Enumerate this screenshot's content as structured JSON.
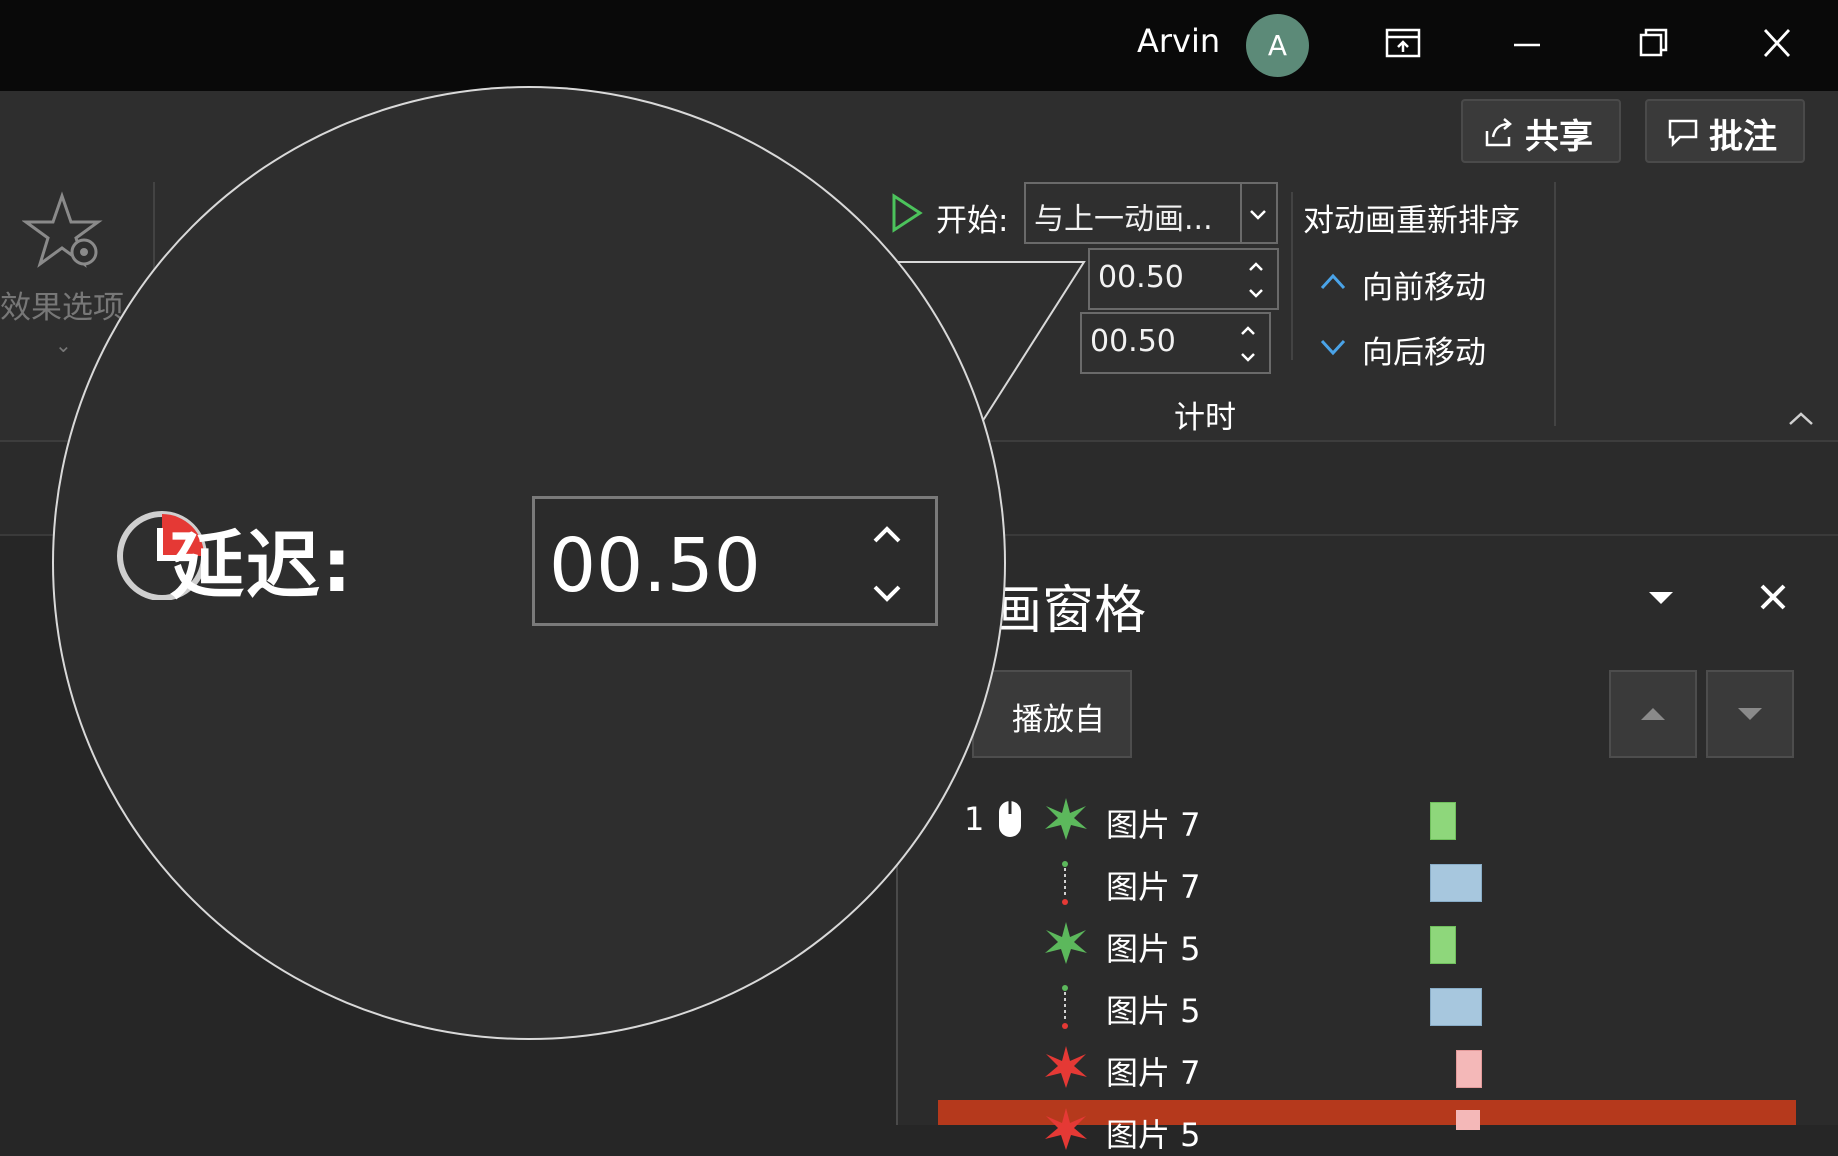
{
  "titlebar": {
    "user_name": "Arvin",
    "avatar_initial": "A",
    "icons": [
      "present-icon",
      "minimize-icon",
      "restore-icon",
      "close-icon"
    ]
  },
  "header_buttons": {
    "share_label": "共享",
    "comment_label": "批注"
  },
  "ribbon": {
    "effect_options_label": "效果选项",
    "start_label": "开始:",
    "start_value": "与上一动画...",
    "duration_value": "00.50",
    "delay_value": "00.50",
    "timing_group_label": "计时",
    "reorder_title": "对动画重新排序",
    "move_earlier_label": "向前移动",
    "move_later_label": "向后移动"
  },
  "animation_pane": {
    "title": "画窗格",
    "play_from_label": "播放自",
    "items": [
      {
        "index": "1",
        "name": "图片 7",
        "icon": "entrance-star-icon",
        "color": "#8ed77b"
      },
      {
        "index": "",
        "name": "图片 7",
        "icon": "motion-path-icon",
        "color": "#a7c7de"
      },
      {
        "index": "",
        "name": "图片 5",
        "icon": "entrance-star-icon",
        "color": "#8ed77b"
      },
      {
        "index": "",
        "name": "图片 5",
        "icon": "motion-path-icon",
        "color": "#a7c7de"
      },
      {
        "index": "",
        "name": "图片 7",
        "icon": "exit-star-icon",
        "color": "#f4b8b8"
      },
      {
        "index": "",
        "name": "图片 5",
        "icon": "exit-star-icon",
        "color": "#f4b8b8"
      }
    ]
  },
  "magnifier": {
    "label": "延迟:",
    "value": "00.50"
  },
  "colors": {
    "accent_blue": "#4aa3e8",
    "selected_row": "#b5391c",
    "entrance_green": "#5cb85c",
    "exit_red": "#e53935"
  }
}
